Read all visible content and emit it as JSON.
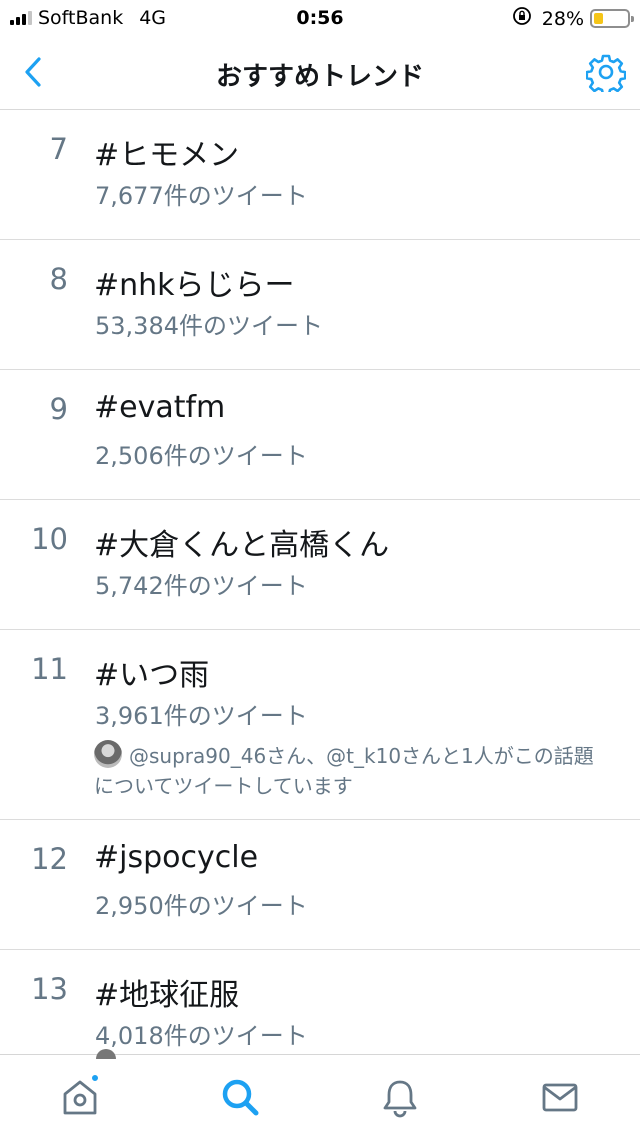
{
  "status_bar": {
    "carrier": "SoftBank",
    "network": "4G",
    "time": "0:56",
    "battery_percent": "28%",
    "battery_level": 0.28,
    "signal_bars": 3,
    "signal_bars_total": 4,
    "lock_icon": "orientation-lock-icon"
  },
  "nav": {
    "title": "おすすめトレンド",
    "back_icon": "chevron-left-icon",
    "settings_icon": "gear-icon"
  },
  "trends": [
    {
      "rank": "7",
      "name": "#ヒモメン",
      "count": "7,677件のツイート"
    },
    {
      "rank": "8",
      "name": "#nhkらじらー",
      "count": "53,384件のツイート"
    },
    {
      "rank": "9",
      "name": "#evatfm",
      "count": "2,506件のツイート"
    },
    {
      "rank": "10",
      "name": "#大倉くんと高橋くん",
      "count": "5,742件のツイート"
    },
    {
      "rank": "11",
      "name": "#いつ雨",
      "count": "3,961件のツイート",
      "context_line1": "@supra90_46さん、@t_k10さんと1人がこの話題",
      "context_line2": "についてツイートしています"
    },
    {
      "rank": "12",
      "name": "#jspocycle",
      "count": "2,950件のツイート"
    },
    {
      "rank": "13",
      "name": "#地球征服",
      "count": "4,018件のツイート"
    }
  ],
  "tab_bar": {
    "items": [
      {
        "name": "home",
        "icon": "home-icon",
        "active": false,
        "badge": true
      },
      {
        "name": "search",
        "icon": "search-icon",
        "active": true,
        "badge": false
      },
      {
        "name": "notifications",
        "icon": "bell-icon",
        "active": false,
        "badge": false
      },
      {
        "name": "messages",
        "icon": "envelope-icon",
        "active": false,
        "badge": false
      }
    ]
  },
  "colors": {
    "accent": "#1da1f2",
    "text_primary": "#14171a",
    "text_secondary": "#657786",
    "divider": "#dcdcdc",
    "battery": "#f5c518",
    "tab_inactive": "#657786"
  }
}
